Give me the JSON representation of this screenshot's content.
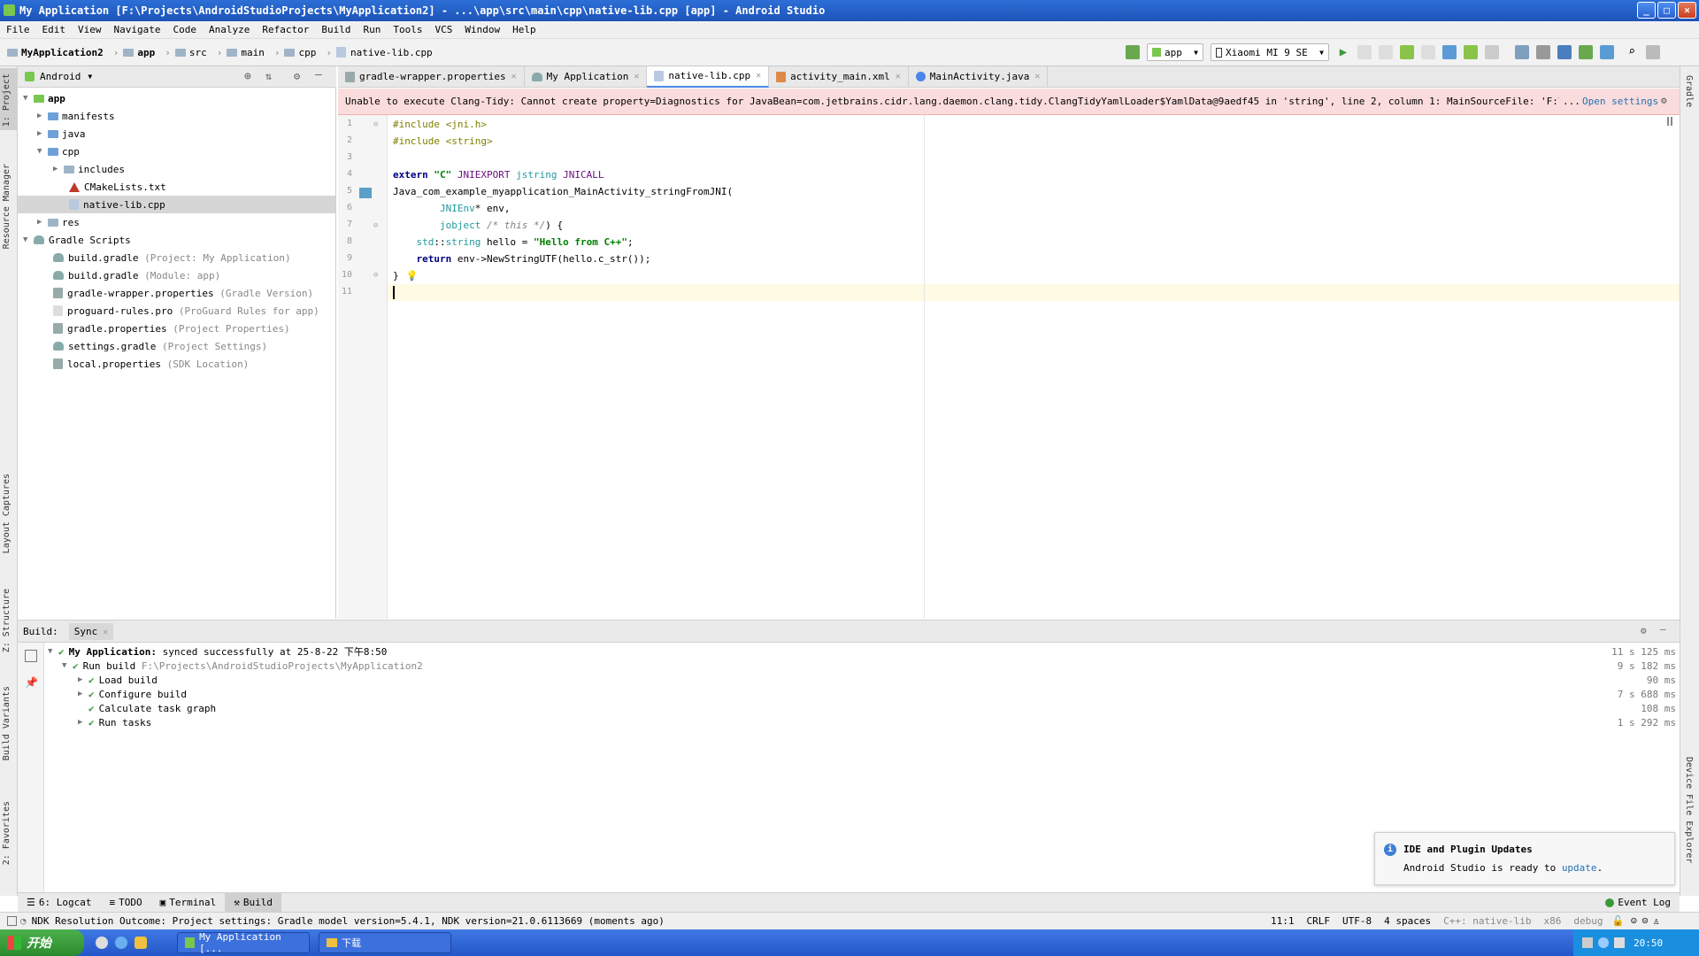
{
  "window": {
    "title": "My Application [F:\\Projects\\AndroidStudioProjects\\MyApplication2] - ...\\app\\src\\main\\cpp\\native-lib.cpp [app] - Android Studio",
    "minimize": "_",
    "maximize": "□",
    "close": "×"
  },
  "menu": [
    "File",
    "Edit",
    "View",
    "Navigate",
    "Code",
    "Analyze",
    "Refactor",
    "Build",
    "Run",
    "Tools",
    "VCS",
    "Window",
    "Help"
  ],
  "breadcrumb": [
    "MyApplication2",
    "app",
    "src",
    "main",
    "cpp",
    "native-lib.cpp"
  ],
  "toolbar": {
    "run_config": "app",
    "device": "Xiaomi MI 9 SE"
  },
  "project_panel": {
    "view": "Android",
    "tree": [
      {
        "label": "app",
        "hint": ""
      },
      {
        "label": "manifests",
        "hint": ""
      },
      {
        "label": "java",
        "hint": ""
      },
      {
        "label": "cpp",
        "hint": ""
      },
      {
        "label": "includes",
        "hint": ""
      },
      {
        "label": "CMakeLists.txt",
        "hint": ""
      },
      {
        "label": "native-lib.cpp",
        "hint": ""
      },
      {
        "label": "res",
        "hint": ""
      },
      {
        "label": "Gradle Scripts",
        "hint": ""
      },
      {
        "label": "build.gradle",
        "hint": "(Project: My Application)"
      },
      {
        "label": "build.gradle",
        "hint": "(Module: app)"
      },
      {
        "label": "gradle-wrapper.properties",
        "hint": "(Gradle Version)"
      },
      {
        "label": "proguard-rules.pro",
        "hint": "(ProGuard Rules for app)"
      },
      {
        "label": "gradle.properties",
        "hint": "(Project Properties)"
      },
      {
        "label": "settings.gradle",
        "hint": "(Project Settings)"
      },
      {
        "label": "local.properties",
        "hint": "(SDK Location)"
      }
    ]
  },
  "left_stripe": {
    "project": "1: Project",
    "resource_manager": "Resource Manager",
    "layout_captures": "Layout Captures",
    "structure": "Z: Structure",
    "build_variants": "Build Variants",
    "favorites": "2: Favorites"
  },
  "right_stripe": {
    "gradle": "Gradle",
    "device_file_explorer": "Device File Explorer"
  },
  "editor": {
    "tabs": [
      "gradle-wrapper.properties",
      "My Application",
      "native-lib.cpp",
      "activity_main.xml",
      "MainActivity.java"
    ],
    "active_tab": 2,
    "error_banner": "Unable to execute Clang-Tidy: Cannot create property=Diagnostics for JavaBean=com.jetbrains.cidr.lang.daemon.clang.tidy.ClangTidyYamlLoader$YamlData@9aedf45 in 'string', line 2, column 1:    MainSourceFile:  'F:\\Projects\\An",
    "error_ellipsis": "...",
    "error_link": "Open settings",
    "line_numbers": [
      "1",
      "2",
      "3",
      "4",
      "5",
      "6",
      "7",
      "8",
      "9",
      "10",
      "11"
    ]
  },
  "build_panel": {
    "label": "Build:",
    "tab": "Sync",
    "rows": [
      {
        "label": "My Application:",
        "detail": "synced successfully at 25-8-22 下午8:50",
        "time": "11 s 125 ms"
      },
      {
        "label": "Run build",
        "detail": "F:\\Projects\\AndroidStudioProjects\\MyApplication2",
        "time": "9 s 182 ms"
      },
      {
        "label": "Load build",
        "detail": "",
        "time": "90 ms"
      },
      {
        "label": "Configure build",
        "detail": "",
        "time": "7 s 688 ms"
      },
      {
        "label": "Calculate task graph",
        "detail": "",
        "time": "108 ms"
      },
      {
        "label": "Run tasks",
        "detail": "",
        "time": "1 s 292 ms"
      }
    ]
  },
  "bottom_tabs": [
    "6: Logcat",
    "TODO",
    "Terminal",
    "Build"
  ],
  "event_log": "Event Log",
  "notification": {
    "title": "IDE and Plugin Updates",
    "body": "Android Studio is ready to",
    "link": "update",
    "period": "."
  },
  "status_bar": {
    "message": "NDK Resolution Outcome: Project settings: Gradle model version=5.4.1, NDK version=21.0.6113669 (moments ago)",
    "position": "11:1",
    "line_sep": "CRLF",
    "encoding": "UTF-8",
    "indent": "4 spaces",
    "context": "C++: native-lib",
    "arch": "x86",
    "build_type": "debug"
  },
  "taskbar": {
    "start": "开始",
    "tasks": [
      "My Application [...",
      "下载"
    ],
    "clock": "20:50"
  }
}
